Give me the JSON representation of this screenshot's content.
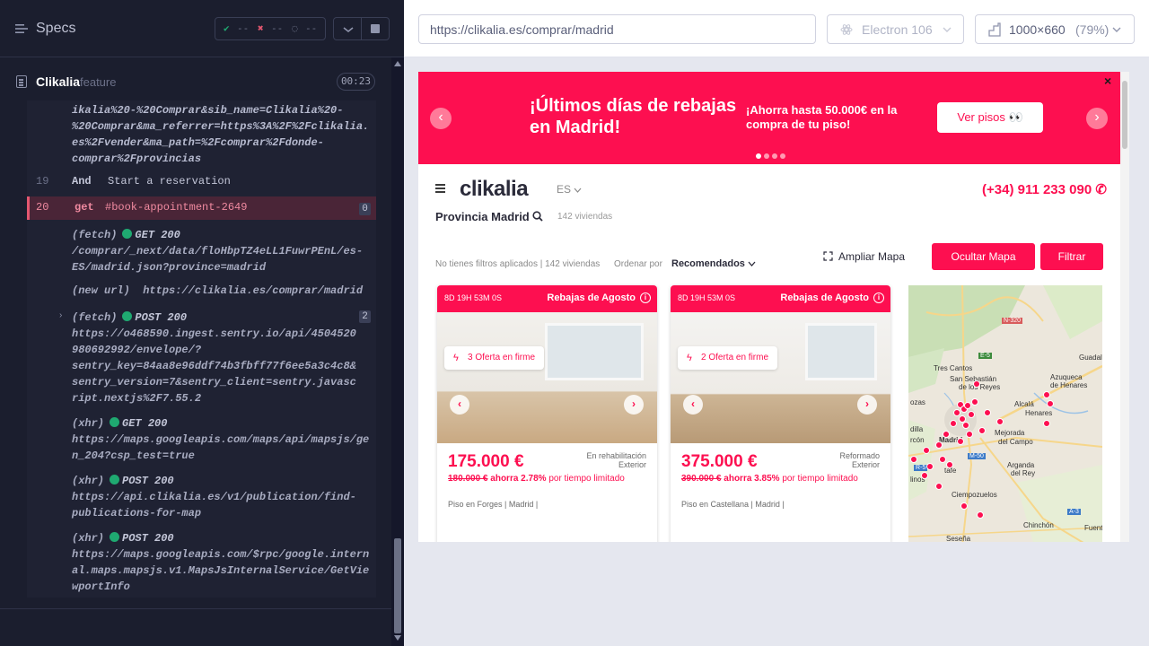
{
  "runner": {
    "specs_label": "Specs",
    "stats": {
      "passed": "--",
      "failed": "--",
      "pending": "--"
    },
    "spec_name": "Clikalia",
    "spec_ext": "feature",
    "timer": "00:23"
  },
  "log": {
    "url_fragment": "ikalia%20-%20Comprar&sib_name=Clikalia%20-\n%20Comprar&ma_referrer=https%3A%2F%2Fclikalia.\nes%2Fvender&ma_path=%2Fcomprar%2Fdonde-\ncomprar%2Fprovincias",
    "step19": {
      "line": "19",
      "keyword": "And",
      "text": "Start a reservation"
    },
    "step20": {
      "line": "20",
      "keyword": "get",
      "text": "#book-appointment-2649",
      "count": "0"
    },
    "events": [
      {
        "type": "(fetch)",
        "method": "GET 200",
        "url": "/comprar/_next/data/floHbpTZ4eLL1FuwrPEnL/es-\nES/madrid.json?province=madrid"
      },
      {
        "type": "(new url)",
        "method": "",
        "url": "https://clikalia.es/comprar/madrid"
      },
      {
        "type": "(fetch)",
        "method": "POST 200",
        "count": "2",
        "url": "https://o468590.ingest.sentry.io/api/4504520\n980692992/envelope/?\nsentry_key=84aa8e96ddf74b3fbff77f6ee5a3c4c8&\nsentry_version=7&sentry_client=sentry.javasc\nript.nextjs%2F7.55.2"
      },
      {
        "type": "(xhr)",
        "method": "GET 200",
        "url": "https://maps.googleapis.com/maps/api/mapsjs/ge\nn_204?csp_test=true"
      },
      {
        "type": "(xhr)",
        "method": "POST 200",
        "url": "https://api.clikalia.es/v1/publication/find-\npublications-for-map"
      },
      {
        "type": "(xhr)",
        "method": "POST 200",
        "url": "https://maps.googleapis.com/$rpc/google.intern\nal.maps.mapsjs.v1.MapsJsInternalService/GetVie\nwportInfo"
      }
    ]
  },
  "browser": {
    "url": "https://clikalia.es/comprar/madrid",
    "browser_name": "Electron 106",
    "viewport": "1000×660",
    "zoom": "(79%)"
  },
  "site": {
    "banner": {
      "headline": "¡Últimos días de rebajas en Madrid!",
      "sub": "¡Ahorra hasta 50.000€ en la compra de tu piso!",
      "button": "Ver pisos 👀",
      "close": "×"
    },
    "logo": "clikalia",
    "lang": "ES",
    "phone": "(+34) 911 233 090",
    "province": "Provincia Madrid",
    "count": "142 viviendas",
    "filter_text": "No tienes filtros aplicados | 142 viviendas",
    "sort_label": "Ordenar por",
    "sort_value": "Recomendados",
    "ampliar": "Ampliar Mapa",
    "ocultar": "Ocultar Mapa",
    "filtrar": "Filtrar",
    "cards": [
      {
        "timer": "8D 19H 53M 0S",
        "promo": "Rebajas de Agosto",
        "offer": "3 Oferta en firme",
        "price": "175.000 €",
        "cond1": "En rehabilitación",
        "cond2": "Exterior",
        "old": "180.000 €",
        "discount": "ahorra 2.78%",
        "limited": "por tiempo limitado",
        "loc": "Piso en Forges | Madrid |"
      },
      {
        "timer": "8D 19H 53M 0S",
        "promo": "Rebajas de Agosto",
        "offer": "2 Oferta en firme",
        "price": "375.000 €",
        "cond1": "Reformado",
        "cond2": "Exterior",
        "old": "390.000 €",
        "discount": "ahorra 3.85%",
        "limited": "por tiempo limitado",
        "loc": "Piso en Castellana | Madrid |"
      }
    ],
    "map_labels": {
      "n320": "N-320",
      "e5": "E-5",
      "tres_cantos": "Tres Cantos",
      "san_seb": "San Sebastián",
      "de_los_reyes": "de los Reyes",
      "azuqueca": "Azuqueca",
      "de_henares": "de Henares",
      "guadal": "Guadala",
      "alcala": "Alcalá",
      "alcala_de": "de",
      "henares": "Henares",
      "mejorada": "Mejorada",
      "del_campo": "del Campo",
      "arganda": "Arganda",
      "del_rey": "del Rey",
      "m50": "M-50",
      "r5": "R-5",
      "ciempozuelos": "Ciempozuelos",
      "chinchon": "Chinchón",
      "a3": "A-3",
      "sesena": "Seseña",
      "fuente": "Fuenti",
      "de_t": "de T",
      "lesa": "esa",
      "getafe": "tafe",
      "llinos": "linos",
      "madrid": "Madrid",
      "a5": "A-5",
      "m40": "M-40",
      "a1": "A-1",
      "ozas": "ozas",
      "dilla": "dilla",
      "rcon": "rcón",
      "m505": "M-505",
      "lmas": "mas",
      "m41": "M-41"
    }
  }
}
